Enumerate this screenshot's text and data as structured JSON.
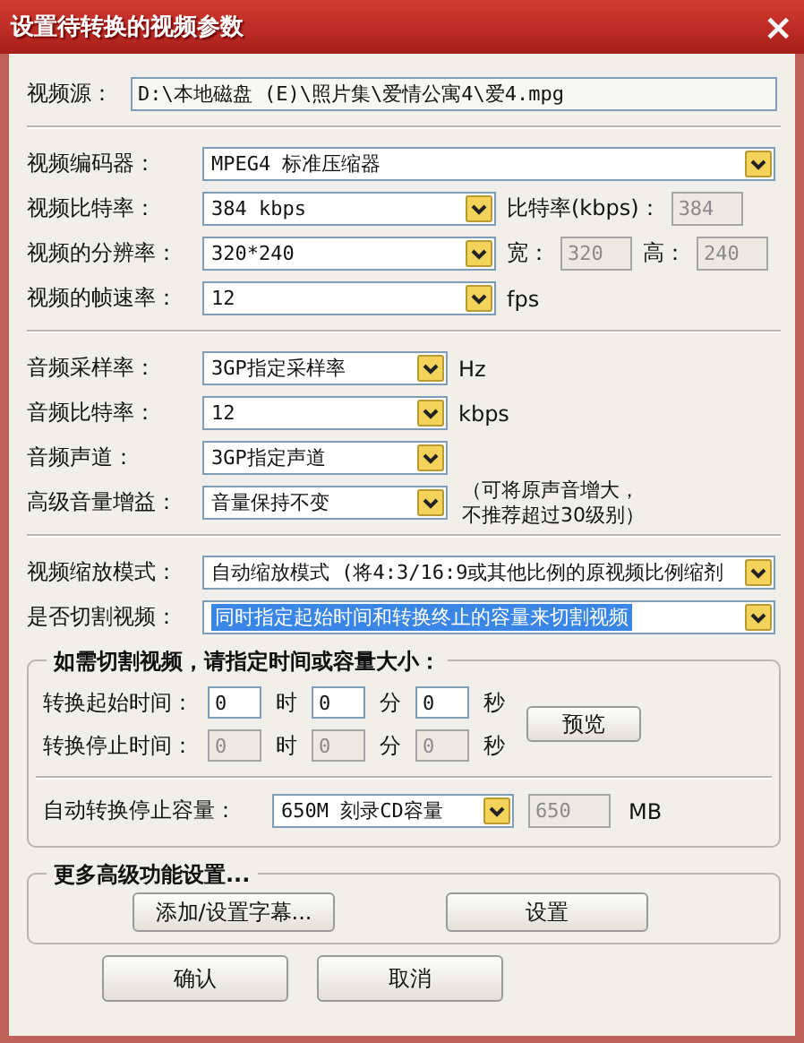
{
  "window": {
    "title": "设置待转换的视频参数",
    "close": "×"
  },
  "source": {
    "label": "视频源：",
    "value": "D:\\本地磁盘 (E)\\照片集\\爱情公寓4\\爱4.mpg"
  },
  "sections": [
    {
      "rows": [
        {
          "kind": "full",
          "label": "视频编码器：",
          "select": "MPEG4 标准压缩器",
          "highlighted": false
        },
        {
          "kind": "short",
          "label": "视频比特率：",
          "select": "384 kbps",
          "highlighted": false,
          "extras": [
            {
              "kind": "text",
              "text": "比特率(kbps)："
            },
            {
              "kind": "field",
              "value": "384",
              "disabled": true
            }
          ]
        },
        {
          "kind": "short",
          "label": "视频的分辨率：",
          "select": "320*240",
          "highlighted": false,
          "extras": [
            {
              "kind": "text",
              "text": "宽："
            },
            {
              "kind": "field",
              "value": "320",
              "disabled": true
            },
            {
              "kind": "text",
              "text": "高："
            },
            {
              "kind": "field",
              "value": "240",
              "disabled": true
            }
          ]
        },
        {
          "kind": "short",
          "label": "视频的帧速率：",
          "select": "12",
          "highlighted": false,
          "extras": [
            {
              "kind": "text",
              "text": "fps"
            }
          ]
        }
      ]
    },
    {
      "rows": [
        {
          "kind": "narrow",
          "label": "音频采样率：",
          "select": "3GP指定采样率",
          "highlighted": false,
          "extras": [
            {
              "kind": "text",
              "text": "Hz"
            }
          ]
        },
        {
          "kind": "narrow",
          "label": "音频比特率：",
          "select": "12",
          "highlighted": false,
          "extras": [
            {
              "kind": "text",
              "text": "kbps"
            }
          ]
        },
        {
          "kind": "narrow",
          "label": "音频声道：",
          "select": "3GP指定声道",
          "highlighted": false
        },
        {
          "kind": "narrow",
          "label": "高级音量增益：",
          "select": "音量保持不变",
          "highlighted": false,
          "extras": [
            {
              "kind": "note",
              "text": "（可将原声音增大，"
            },
            {
              "kind": "note",
              "text": "不推荐超过30级别）"
            }
          ]
        }
      ]
    },
    {
      "rows": [
        {
          "kind": "full",
          "label": "视频缩放模式：",
          "select": "自动缩放模式 (将4:3/16:9或其他比例的原视频比例缩剂",
          "highlighted": false
        },
        {
          "kind": "full",
          "label": "是否切割视频：",
          "select": "同时指定起始时间和转换终止的容量来切割视频",
          "highlighted": true
        }
      ]
    }
  ],
  "cut_group": {
    "title": "如需切割视频，请指定时间或容量大小：",
    "times": [
      {
        "label": "转换起始时间：",
        "fields": [
          {
            "value": "0",
            "unit": "时",
            "disabled": false
          },
          {
            "value": "0",
            "unit": "分",
            "disabled": false
          },
          {
            "value": "0",
            "unit": "秒",
            "disabled": false
          }
        ]
      },
      {
        "label": "转换停止时间：",
        "fields": [
          {
            "value": "0",
            "unit": "时",
            "disabled": true
          },
          {
            "value": "0",
            "unit": "分",
            "disabled": true
          },
          {
            "value": "0",
            "unit": "秒",
            "disabled": true
          }
        ]
      }
    ],
    "preview_button": "预览",
    "capacity": {
      "label": "自动转换停止容量：",
      "select": "650M 刻录CD容量",
      "value": "650",
      "disabled": true,
      "unit": "MB"
    }
  },
  "advanced_group": {
    "title": "更多高级功能设置...",
    "buttons": [
      "添加/设置字幕...",
      "设置"
    ]
  },
  "buttons": [
    "确认",
    "取消"
  ]
}
